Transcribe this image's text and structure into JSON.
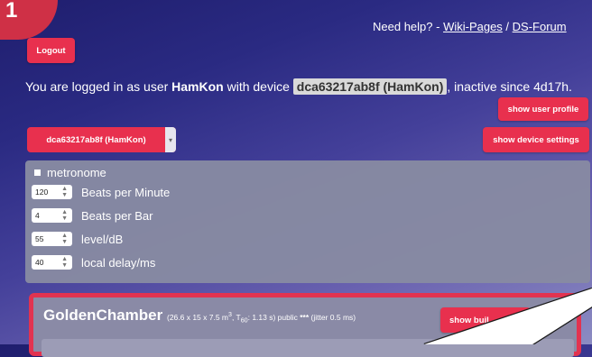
{
  "badge": {
    "number": "1"
  },
  "help": {
    "prefix": "Need help? - ",
    "wiki_link": "Wiki-Pages",
    "separator": " / ",
    "forum_link": "DS-Forum"
  },
  "logout_label": "Logout",
  "login_info": {
    "before_user": "You are logged in as user ",
    "user": "HamKon",
    "before_device": " with device ",
    "device": "dca63217ab8f (HamKon)",
    "after_device": ", inactive since 4d17h."
  },
  "buttons": {
    "show_user_profile": "show user profile",
    "show_device_settings": "show device settings",
    "show_builtin": "show buil"
  },
  "device_select": {
    "selected": "dca63217ab8f (HamKon)"
  },
  "metronome": {
    "label": "metronome",
    "rows": [
      {
        "value": "120",
        "label": "Beats per Minute"
      },
      {
        "value": "4",
        "label": "Beats per Bar"
      },
      {
        "value": "55",
        "label": "level/dB"
      },
      {
        "value": "40",
        "label": "local delay/ms"
      }
    ]
  },
  "chamber": {
    "name": "GoldenChamber",
    "dims": "(26.6 x 15 x 7.5 m",
    "dims_sup": "3",
    "t_label": ", T",
    "t_sub": "60",
    "t_value": ": 1.13 s) public ",
    "stars": "***",
    "jitter": " (jitter 0.5 ms)"
  }
}
